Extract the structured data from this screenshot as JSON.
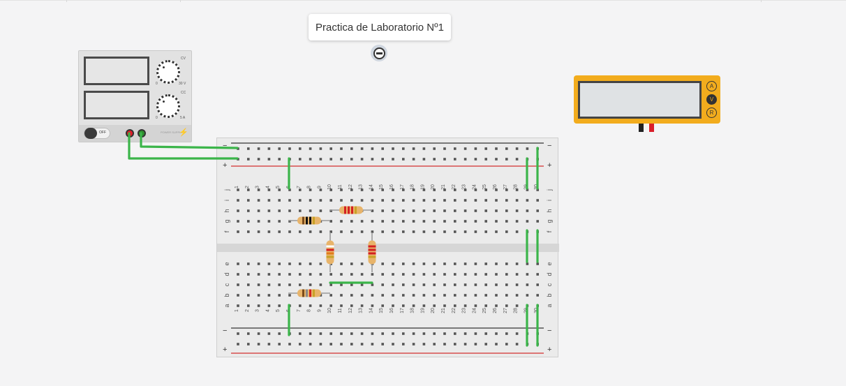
{
  "note": {
    "text": "Practica de Laboratorio Nº1"
  },
  "power_supply": {
    "switch_label": "OFF",
    "voltage_max": "30 V",
    "voltage_min": "0",
    "current_max": "5 A",
    "current_min": "0",
    "cv_label": "CV",
    "cc_label": "CC",
    "brand": "POWER SUPPLY"
  },
  "multimeter": {
    "modes": [
      "A",
      "V",
      "R"
    ],
    "active_mode": "V"
  },
  "breadboard": {
    "columns": [
      "1",
      "2",
      "3",
      "4",
      "5",
      "6",
      "7",
      "8",
      "9",
      "10",
      "11",
      "12",
      "13",
      "14",
      "15",
      "16",
      "17",
      "18",
      "19",
      "20",
      "21",
      "22",
      "23",
      "24",
      "25",
      "26",
      "27",
      "28",
      "29",
      "30"
    ],
    "rows_top": [
      "j",
      "i",
      "h",
      "g",
      "f"
    ],
    "rows_bottom": [
      "e",
      "d",
      "c",
      "b",
      "a"
    ],
    "rail_minus": "−",
    "rail_plus": "+"
  },
  "colors": {
    "wire": "#3bb54a",
    "rail_red": "#d32f2f",
    "rail_black": "#333333",
    "resistor_body": "#e8b46a",
    "multimeter_body": "#f2ac1d"
  }
}
